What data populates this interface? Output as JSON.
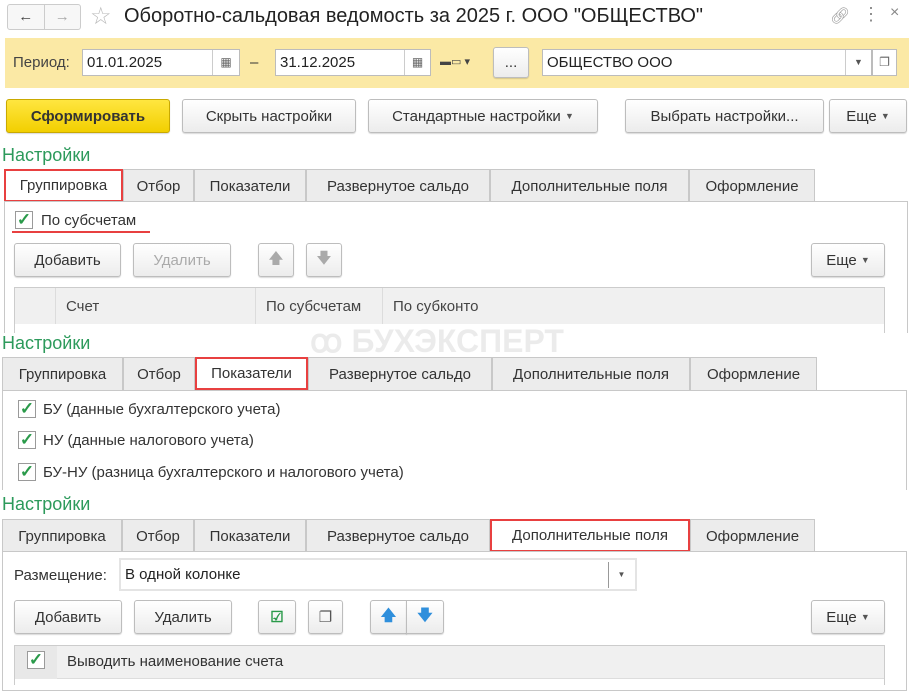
{
  "header": {
    "title": "Оборотно-сальдовая ведомость за 2025 г. ООО \"ОБЩЕСТВО\"",
    "back": "←",
    "forward": "→"
  },
  "period": {
    "label": "Период:",
    "from": "01.01.2025",
    "dash": "–",
    "to": "31.12.2025",
    "more": "...",
    "org": "ОБЩЕСТВО ООО"
  },
  "toolbar": {
    "generate": "Сформировать",
    "hide": "Скрыть настройки",
    "standard": "Стандартные настройки",
    "choose": "Выбрать настройки...",
    "more": "Еще"
  },
  "tabs": [
    "Группировка",
    "Отбор",
    "Показатели",
    "Развернутое сальдо",
    "Дополнительные поля",
    "Оформление"
  ],
  "settings_label": "Настройки",
  "grouping": {
    "by_subaccounts": "По субсчетам",
    "add": "Добавить",
    "delete": "Удалить",
    "more": "Еще",
    "columns": [
      "Счет",
      "По субсчетам",
      "По субконто"
    ]
  },
  "indicators": {
    "items": [
      "БУ (данные бухгалтерского учета)",
      "НУ (данные налогового учета)",
      "БУ-НУ (разница бухгалтерского и налогового учета)"
    ]
  },
  "extra": {
    "placement_label": "Размещение:",
    "placement_value": "В одной колонке",
    "add": "Добавить",
    "delete": "Удалить",
    "more": "Еще",
    "row": "Выводить наименование счета"
  },
  "watermark": "БУХЭКСПЕРТ",
  "colors": {
    "accent": "#2c9a5b",
    "highlight": "#e84040",
    "period_bg": "#fbe9a5"
  }
}
